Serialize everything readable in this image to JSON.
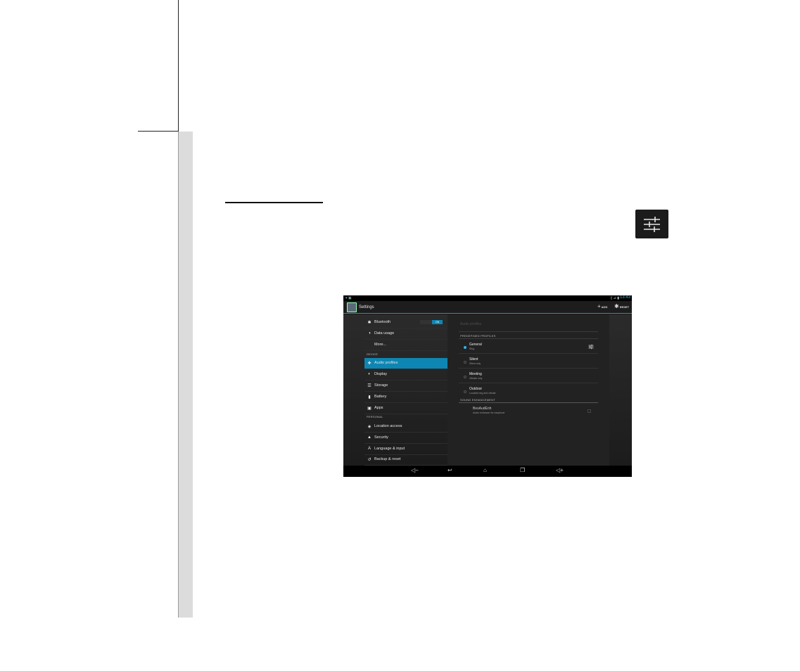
{
  "screenshot": {
    "statusbar": {
      "left_icons": "▾ ▣",
      "right_icons": "▯ ⊿ ▮",
      "time": "13:43"
    },
    "actionbar": {
      "title": "Settings",
      "add_label": "ADD",
      "reset_label": "RESET"
    },
    "left_menu": {
      "items_top": [
        {
          "label": "Bluetooth",
          "icon": "bluetooth-icon",
          "glyph": "✱"
        },
        {
          "label": "Data usage",
          "icon": "data-usage-icon",
          "glyph": "◑"
        },
        {
          "label": "More...",
          "icon": "",
          "glyph": ""
        }
      ],
      "bluetooth_toggle": "ON",
      "section_device": "DEVICE",
      "items_device": [
        {
          "label": "Audio profiles",
          "icon": "audio-profiles-icon",
          "glyph": "✚",
          "selected": true
        },
        {
          "label": "Display",
          "icon": "display-icon",
          "glyph": "◐"
        },
        {
          "label": "Storage",
          "icon": "storage-icon",
          "glyph": "☰"
        },
        {
          "label": "Battery",
          "icon": "battery-icon",
          "glyph": "▮"
        },
        {
          "label": "Apps",
          "icon": "apps-icon",
          "glyph": "▣"
        }
      ],
      "section_personal": "PERSONAL",
      "items_personal": [
        {
          "label": "Location access",
          "icon": "location-icon",
          "glyph": "◈"
        },
        {
          "label": "Security",
          "icon": "lock-icon",
          "glyph": "▲"
        },
        {
          "label": "Language & input",
          "icon": "language-icon",
          "glyph": "A"
        },
        {
          "label": "Backup & reset",
          "icon": "backup-icon",
          "glyph": "↺"
        }
      ]
    },
    "right_panel": {
      "title": "Audio profiles",
      "section_predefined": "PREDEFINED PROFILES",
      "profiles": [
        {
          "name": "General",
          "sub": "Ring",
          "selected": true
        },
        {
          "name": "Silent",
          "sub": "Silent only",
          "selected": false
        },
        {
          "name": "Meeting",
          "sub": "Vibrate only",
          "selected": false
        },
        {
          "name": "Outdoor",
          "sub": "Loudest ring and vibrate",
          "selected": false
        }
      ],
      "section_enhancement": "SOUND ENHANCEMENT",
      "enhancement": {
        "name": "BesAudEnh",
        "sub": "Audio enhancer for earphone"
      }
    },
    "navbar": {
      "vol_down": "◁−",
      "back": "↩",
      "home": "⌂",
      "recents": "❐",
      "vol_up": "◁+"
    }
  },
  "colors": {
    "accent": "#33b5e5",
    "selected_row": "#0e86b3"
  }
}
